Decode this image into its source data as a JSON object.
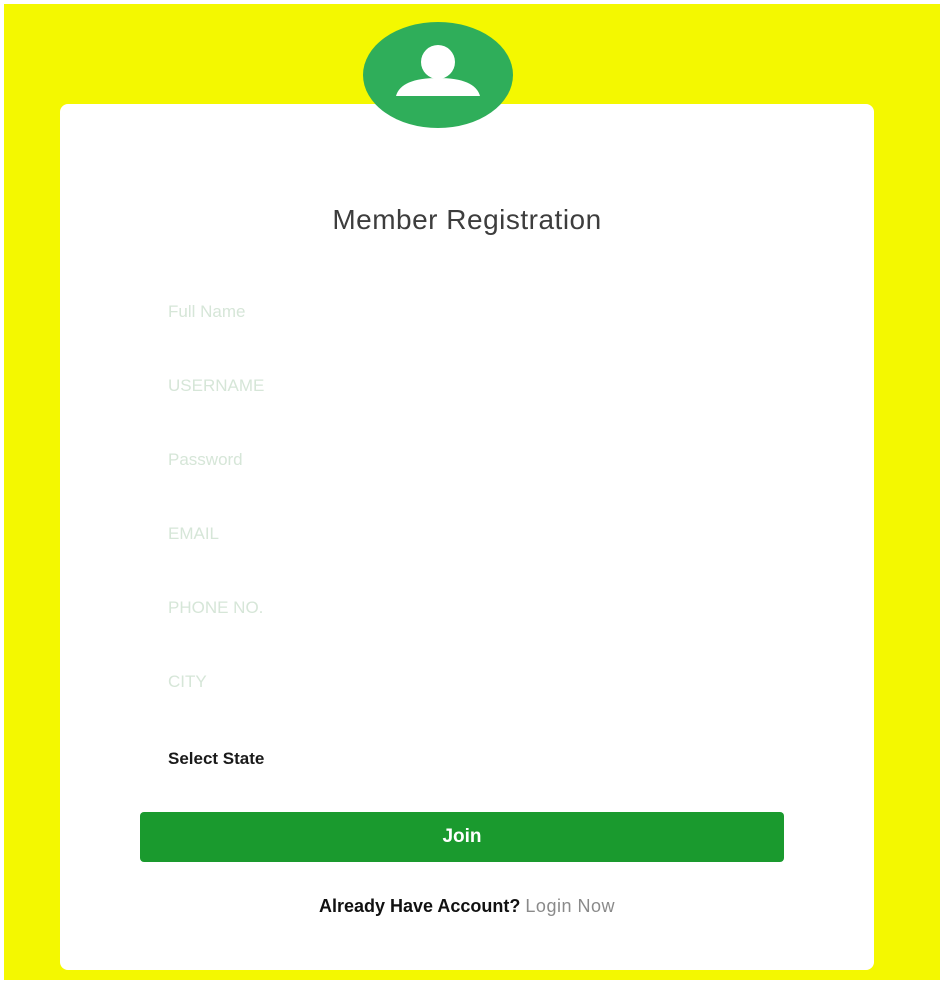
{
  "form": {
    "title": "Member Registration",
    "fields": {
      "full_name": {
        "placeholder": "Full Name"
      },
      "username": {
        "placeholder": "USERNAME"
      },
      "password": {
        "placeholder": "Password"
      },
      "email": {
        "placeholder": "EMAIL"
      },
      "phone": {
        "placeholder": "PHONE NO."
      },
      "city": {
        "placeholder": "CITY"
      }
    },
    "state_select": {
      "selected": "Select State"
    },
    "join_label": "Join",
    "footer": {
      "question": "Already Have Account?",
      "login_label": "Login Now"
    }
  },
  "icons": {
    "avatar": "user-icon"
  },
  "colors": {
    "background": "#f4f800",
    "card": "#ffffff",
    "avatar": "#2fae5a",
    "button": "#1a9a2e",
    "placeholder": "#d6e6d8",
    "link": "#8a8a8a"
  }
}
